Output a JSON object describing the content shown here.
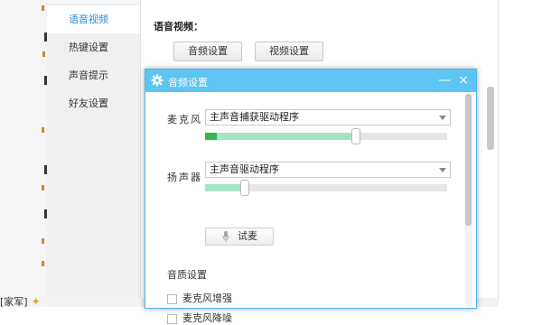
{
  "sidebar": {
    "items": [
      {
        "label": "语音视频",
        "active": true
      },
      {
        "label": "热键设置",
        "active": false
      },
      {
        "label": "声音提示",
        "active": false
      },
      {
        "label": "好友设置",
        "active": false
      }
    ]
  },
  "main": {
    "section_title": "语音视频：",
    "tabs": [
      {
        "label": "音频设置"
      },
      {
        "label": "视频设置"
      }
    ]
  },
  "background": {
    "partial_text": "[家军]"
  },
  "dialog": {
    "title": "音频设置",
    "minimize_symbol": "—",
    "close_symbol": "×",
    "microphone": {
      "label": "麦克风",
      "device": "主声音捕获驱动程序",
      "volume_fraction": 0.62,
      "level_fraction": 0.05
    },
    "speaker": {
      "label": "扬声器",
      "device": "主声音驱动程序",
      "volume_fraction": 0.16
    },
    "test_button_label": "试麦",
    "quality_title": "音质设置",
    "options": [
      {
        "label": "麦克风增强",
        "checked": false
      },
      {
        "label": "麦克风降噪",
        "checked": false
      }
    ]
  },
  "colors": {
    "accent": "#5ec4f1",
    "active_text": "#2b8bd8",
    "level": "#36b553",
    "volume_fill": "#a6e3c3"
  }
}
